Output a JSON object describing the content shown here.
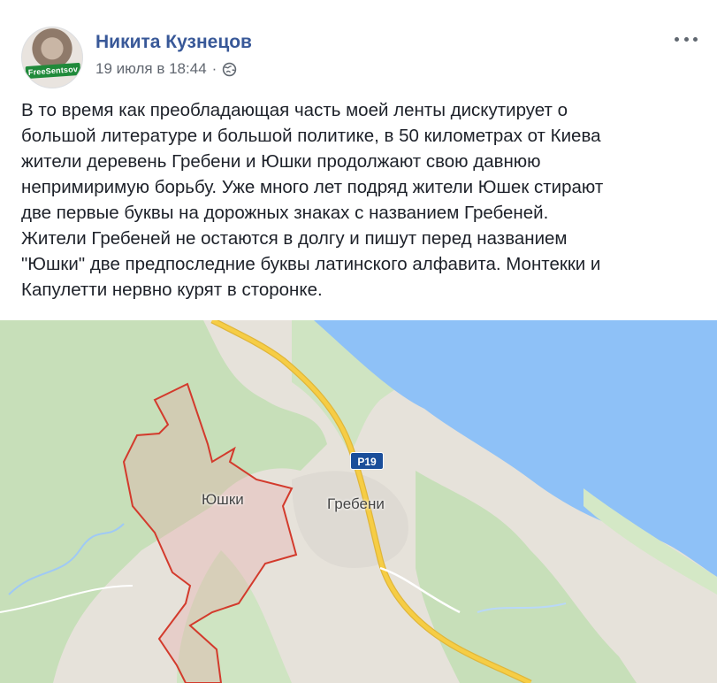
{
  "post": {
    "author": {
      "name": "Никита Кузнецов",
      "avatar_badge": "FreeSentsov"
    },
    "timestamp": "19 июля в 18:44",
    "separator": "·",
    "privacy_icon": "globe-icon",
    "more_icon": "more-dots-icon",
    "text_lines": [
      "В то время как преобладающая часть моей ленты дискутирует о",
      "большой литературе и большой политике, в 50 километрах от Киева",
      "жители деревень Гребени и Юшки продолжают свою давнюю",
      "непримиримую борьбу. Уже много лет подряд жители Юшек стирают",
      "две первые буквы на дорожных знаках с названием Гребеней.",
      "Жители Гребеней не остаются в долгу и пишут перед названием",
      "\"Юшки\" две предпоследние буквы латинского алфавита. Монтекки и",
      "Капулетти нервно курят в сторонке."
    ]
  },
  "map": {
    "labels": {
      "village_1": "Юшки",
      "village_2": "Гребени",
      "road": "Р19"
    },
    "colors": {
      "water": "#8ec1f7",
      "forest": "#c7dfb9",
      "land": "#e6e2da",
      "road": "#f6cd45",
      "boundary": "#d33a2c",
      "shield": "#1a4e9a"
    }
  }
}
